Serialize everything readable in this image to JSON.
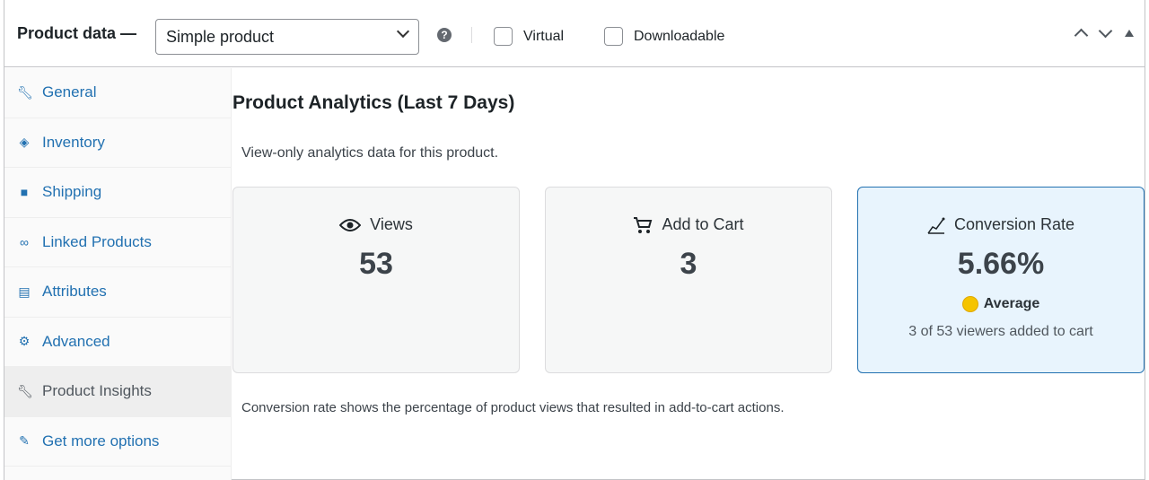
{
  "header": {
    "title": "Product data —",
    "product_type": "Simple product",
    "help": "?",
    "virtual_label": "Virtual",
    "downloadable_label": "Downloadable"
  },
  "sidebar": {
    "items": [
      {
        "label": "General",
        "icon": "wrench-icon"
      },
      {
        "label": "Inventory",
        "icon": "tag-icon"
      },
      {
        "label": "Shipping",
        "icon": "truck-icon"
      },
      {
        "label": "Linked Products",
        "icon": "link-icon"
      },
      {
        "label": "Attributes",
        "icon": "list-icon"
      },
      {
        "label": "Advanced",
        "icon": "gear-icon"
      },
      {
        "label": "Product Insights",
        "icon": "wrench-icon"
      },
      {
        "label": "Get more options",
        "icon": "plugin-icon"
      }
    ]
  },
  "main": {
    "title": "Product Analytics (Last 7 Days)",
    "description": "View-only analytics data for this product.",
    "cards": [
      {
        "label": "Views",
        "value": "53"
      },
      {
        "label": "Add to Cart",
        "value": "3"
      },
      {
        "label": "Conversion Rate",
        "value": "5.66%",
        "rating": "Average",
        "detail": "3 of 53 viewers added to cart"
      }
    ],
    "footnote": "Conversion rate shows the percentage of product views that resulted in add-to-cart actions."
  },
  "colors": {
    "link": "#2271b1",
    "highlight_bg": "#e8f4fd",
    "rating_dot": "#f5c400"
  }
}
